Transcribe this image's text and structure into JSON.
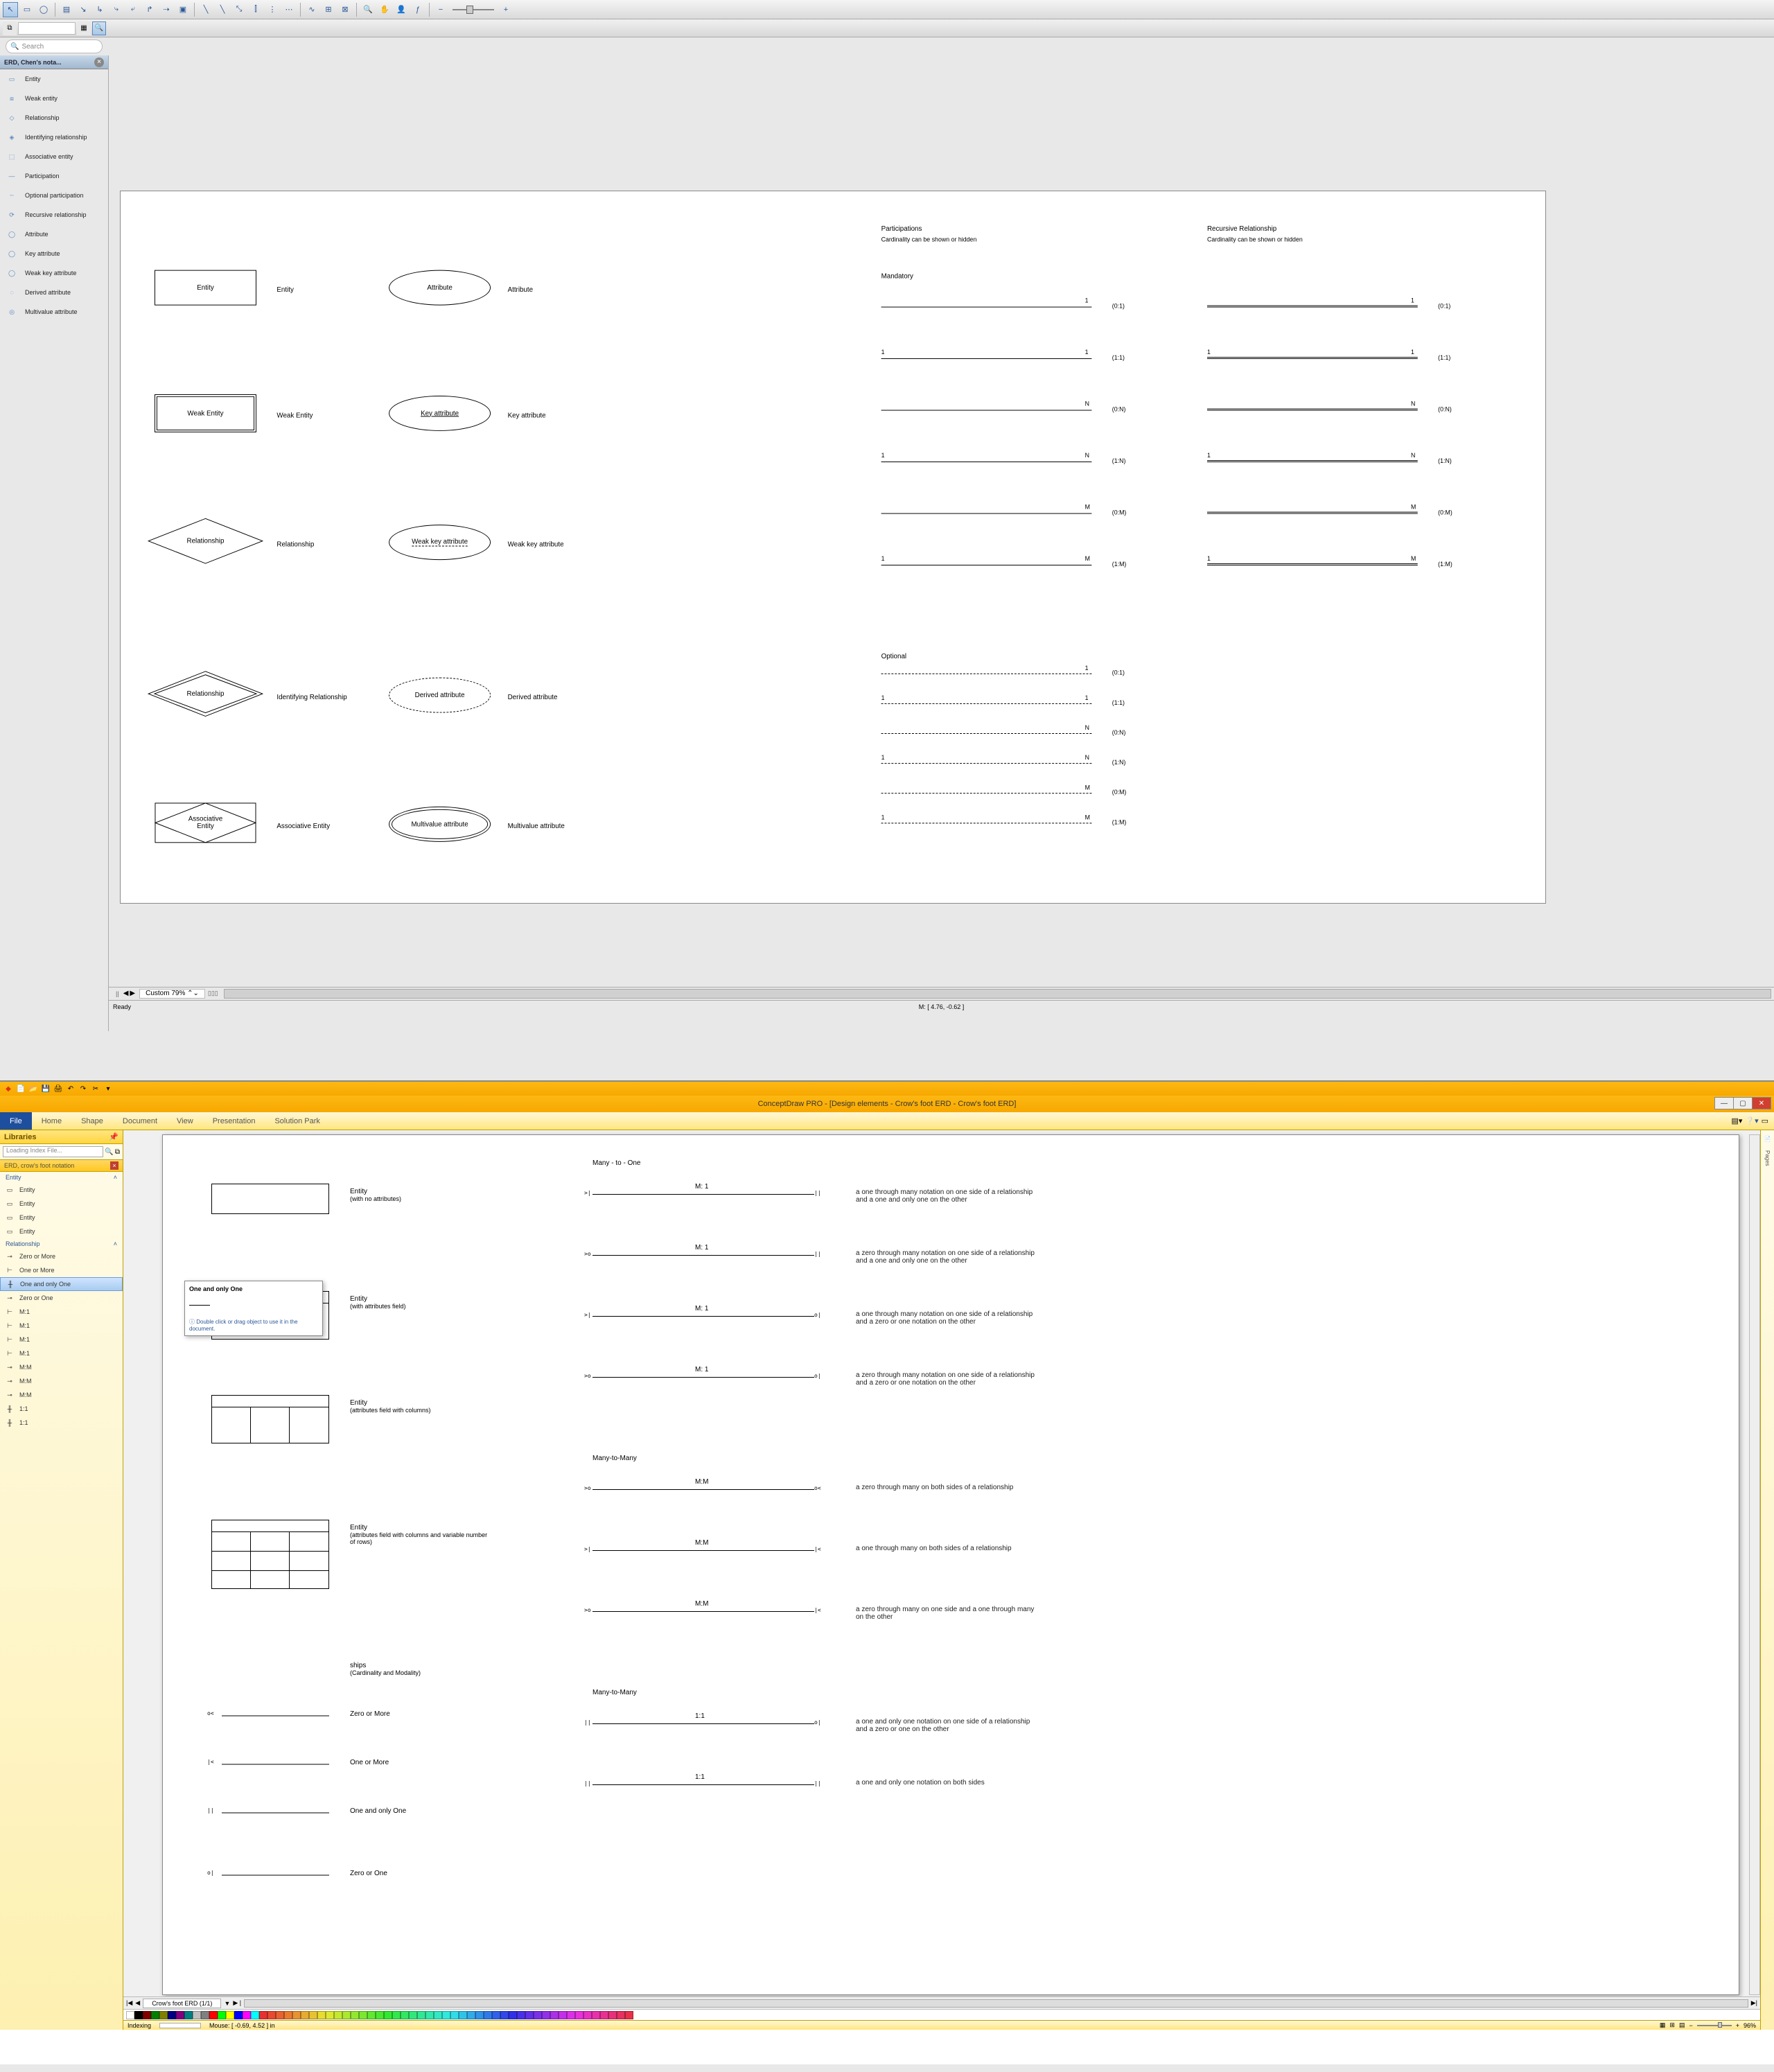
{
  "app1": {
    "search_placeholder": "Search",
    "library": {
      "title": "ERD, Chen's nota...",
      "items": [
        "Entity",
        "Weak entity",
        "Relationship",
        "Identifying relationship",
        "Associative entity",
        "Participation",
        "Optional participation",
        "Recursive relationship",
        "Attribute",
        "Key attribute",
        "Weak key attribute",
        "Derived attribute",
        "Multivalue attribute"
      ]
    },
    "canvas": {
      "col1": [
        {
          "shape": "Entity",
          "label": "Entity"
        },
        {
          "shape": "Weak Entity",
          "label": "Weak Entity"
        },
        {
          "shape": "Relationship",
          "label": "Relationship"
        },
        {
          "shape": "Relationship",
          "label": "Identifying Relationship"
        },
        {
          "shape": "Associative Entity",
          "label": "Associative Entity"
        }
      ],
      "col2": [
        {
          "shape": "Attribute",
          "label": "Attribute"
        },
        {
          "shape": "Key attribute",
          "label": "Key attribute"
        },
        {
          "shape": "Weak key attribute",
          "label": "Weak key attribute"
        },
        {
          "shape": "Derived attribute",
          "label": "Derived attribute"
        },
        {
          "shape": "Multivalue attribute",
          "label": "Multivalue attribute"
        }
      ],
      "participations_title": "Participations",
      "participations_sub": "Cardinality can be shown or hidden",
      "recursive_title": "Recursive Relationship",
      "recursive_sub": "Cardinality can be shown or hidden",
      "mandatory_title": "Mandatory",
      "optional_title": "Optional",
      "mandatory_rows": [
        {
          "left": "",
          "right": "1",
          "card": "(0:1)"
        },
        {
          "left": "1",
          "right": "1",
          "card": "(1:1)"
        },
        {
          "left": "",
          "right": "N",
          "card": "(0:N)"
        },
        {
          "left": "1",
          "right": "N",
          "card": "(1:N)"
        },
        {
          "left": "",
          "right": "M",
          "card": "(0:M)"
        },
        {
          "left": "1",
          "right": "M",
          "card": "(1:M)"
        }
      ],
      "optional_rows": [
        {
          "left": "",
          "right": "1",
          "card": "(0:1)"
        },
        {
          "left": "1",
          "right": "1",
          "card": "(1:1)"
        },
        {
          "left": "",
          "right": "N",
          "card": "(0:N)"
        },
        {
          "left": "1",
          "right": "N",
          "card": "(1:N)"
        },
        {
          "left": "",
          "right": "M",
          "card": "(0:M)"
        },
        {
          "left": "1",
          "right": "M",
          "card": "(1:M)"
        }
      ]
    },
    "zoom": "Custom 79%",
    "mouse": "M: [ 4.76, -0.62 ]",
    "status": "Ready"
  },
  "app2": {
    "title": "ConceptDraw PRO - [Design elements - Crow's foot ERD - Crow's foot ERD]",
    "ribbon": {
      "file": "File",
      "tabs": [
        "Home",
        "Shape",
        "Document",
        "View",
        "Presentation",
        "Solution Park"
      ]
    },
    "panel_title": "Libraries",
    "search_placeholder": "Loading Index File...",
    "lib_header": "ERD, crow's foot notation",
    "groups": {
      "entity": {
        "label": "Entity",
        "items": [
          "Entity",
          "Entity",
          "Entity",
          "Entity"
        ]
      },
      "relationship": {
        "label": "Relationship",
        "items": [
          "Zero or More",
          "One or More",
          "One and only One",
          "Zero or One",
          "M:1",
          "M:1",
          "M:1",
          "M:1",
          "M:M",
          "M:M",
          "M:M",
          "1:1",
          "1:1"
        ]
      }
    },
    "selected_item": "One and only One",
    "tooltip": {
      "title": "One and only One",
      "hint": "Double click or drag object to use it in the document."
    },
    "canvas": {
      "entities": [
        {
          "title": "Entity",
          "sub": "(with no attributes)"
        },
        {
          "title": "Entity",
          "sub": "(with attributes field)"
        },
        {
          "title": "Entity",
          "sub": "(attributes field with columns)"
        },
        {
          "title": "Entity",
          "sub": "(attributes field with columns and variable number of rows)"
        }
      ],
      "rels_title": "ships",
      "rels_sub": "(Cardinality and Modality)",
      "rel_items": [
        "Zero or More",
        "One or More",
        "One and only One",
        "Zero or One"
      ],
      "sections": [
        {
          "title": "Many - to - One",
          "rows": [
            {
              "label": "M: 1",
              "desc": "a one through many notation on one side of a relationship and a one and only one on the other"
            },
            {
              "label": "M: 1",
              "desc": "a zero through many notation on one side of a relationship and a one and only one on the other"
            },
            {
              "label": "M: 1",
              "desc": "a one through many notation on one side of a relationship and a zero or one notation on the other"
            },
            {
              "label": "M: 1",
              "desc": "a zero through many notation on one side of a relationship and a zero or one notation on the other"
            }
          ]
        },
        {
          "title": "Many-to-Many",
          "rows": [
            {
              "label": "M:M",
              "desc": "a zero through many on both sides of a relationship"
            },
            {
              "label": "M:M",
              "desc": "a one through many on both sides of a relationship"
            },
            {
              "label": "M:M",
              "desc": "a zero through many on one side and a one through many on the other"
            }
          ]
        },
        {
          "title": "Many-to-Many",
          "rows": [
            {
              "label": "1:1",
              "desc": "a one and only one notation on one side of a relationship and a zero or one on the other"
            },
            {
              "label": "1:1",
              "desc": "a one and only one notation on both sides"
            }
          ]
        }
      ]
    },
    "tab": "Crow's foot ERD (1/1)",
    "status_left": "Indexing",
    "status_mouse": "Mouse: [ -0.69, 4.52 ] in",
    "status_zoom": "96%",
    "right_tab": "Pages"
  }
}
